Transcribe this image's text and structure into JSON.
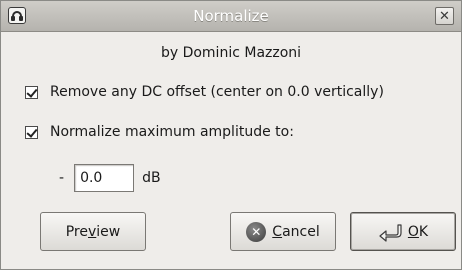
{
  "window": {
    "title": "Normalize"
  },
  "author": "by Dominic Mazzoni",
  "options": {
    "remove_dc": {
      "label": "Remove any DC offset (center on 0.0 vertically)",
      "checked": true
    },
    "normalize_amp": {
      "label": "Normalize maximum amplitude to:",
      "checked": true
    }
  },
  "amplitude": {
    "sign": "-",
    "value": "0.0",
    "unit": "dB"
  },
  "buttons": {
    "preview": {
      "pre": "Pre",
      "mnemonic": "v",
      "post": "iew"
    },
    "cancel": {
      "pre": "",
      "mnemonic": "C",
      "post": "ancel"
    },
    "ok": {
      "pre": "",
      "mnemonic": "O",
      "post": "K"
    }
  },
  "icons": {
    "app": "headphones-icon",
    "close": "close-icon",
    "cancel": "cancel-icon",
    "ok": "ok-arrow-icon"
  }
}
